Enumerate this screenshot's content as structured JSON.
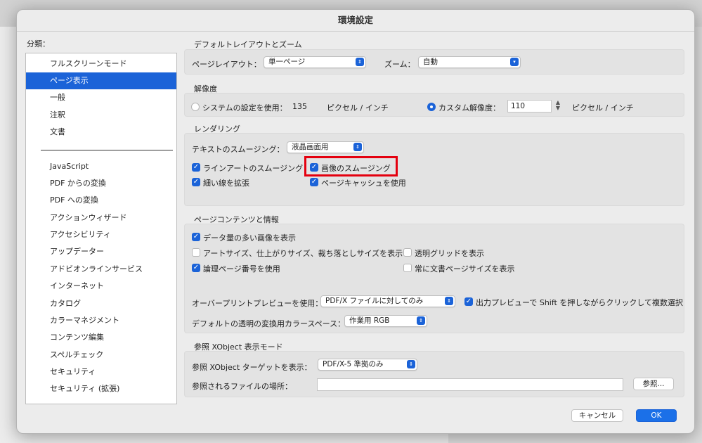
{
  "window": {
    "title": "環境設定"
  },
  "sidebar": {
    "label": "分類：",
    "items_top": [
      "フルスクリーンモード",
      "ページ表示",
      "一般",
      "注釈",
      "文書"
    ],
    "selected": "ページ表示",
    "items_bottom": [
      "JavaScript",
      "PDF からの変換",
      "PDF への変換",
      "アクションウィザード",
      "アクセシビリティ",
      "アップデーター",
      "アドビオンラインサービス",
      "インターネット",
      "カタログ",
      "カラーマネジメント",
      "コンテンツ編集",
      "スペルチェック",
      "セキュリティ",
      "セキュリティ (拡張)"
    ]
  },
  "layout_zoom": {
    "title": "デフォルトレイアウトとズーム",
    "page_layout_label": "ページレイアウト：",
    "page_layout_value": "単一ページ",
    "zoom_label": "ズーム：",
    "zoom_value": "自動"
  },
  "resolution": {
    "title": "解像度",
    "system_label": "システムの設定を使用：",
    "system_value": "135",
    "system_unit": "ピクセル / インチ",
    "custom_label": "カスタム解像度：",
    "custom_value": "110",
    "custom_unit": "ピクセル / インチ",
    "selected": "custom"
  },
  "rendering": {
    "title": "レンダリング",
    "text_smoothing_label": "テキストのスムージング：",
    "text_smoothing_value": "液晶画面用",
    "lineart_smoothing": {
      "label": "ラインアートのスムージング",
      "checked": true
    },
    "image_smoothing": {
      "label": "画像のスムージング",
      "checked": true
    },
    "enhance_thin_lines": {
      "label": "細い線を拡張",
      "checked": true
    },
    "page_cache": {
      "label": "ページキャッシュを使用",
      "checked": true
    }
  },
  "content_info": {
    "title": "ページコンテンツと情報",
    "large_images": {
      "label": "データ量の多い画像を表示",
      "checked": true
    },
    "art_trim_bleed": {
      "label": "アートサイズ、仕上がりサイズ、裁ち落としサイズを表示",
      "checked": false
    },
    "transparency_grid": {
      "label": "透明グリッドを表示",
      "checked": false
    },
    "logical_page_numbers": {
      "label": "論理ページ番号を使用",
      "checked": true
    },
    "always_doc_page_size": {
      "label": "常に文書ページサイズを表示",
      "checked": false
    },
    "overprint_label": "オーバープリントプレビューを使用：",
    "overprint_value": "PDF/X ファイルに対してのみ",
    "output_preview": {
      "label": "出力プレビューで Shift を押しながらクリックして複数選択",
      "checked": true
    },
    "blend_space_label": "デフォルトの透明の変換用カラースペース：",
    "blend_space_value": "作業用 RGB"
  },
  "xobject": {
    "title": "参照 XObject 表示モード",
    "target_label": "参照 XObject ターゲットを表示：",
    "target_value": "PDF/X-5 準拠のみ",
    "location_label": "参照されるファイルの場所：",
    "location_value": "",
    "browse_label": "参照..."
  },
  "footer": {
    "cancel_label": "キャンセル",
    "ok_label": "OK"
  },
  "colors": {
    "accent": "#1b63d8",
    "highlight": "#e4000f"
  }
}
